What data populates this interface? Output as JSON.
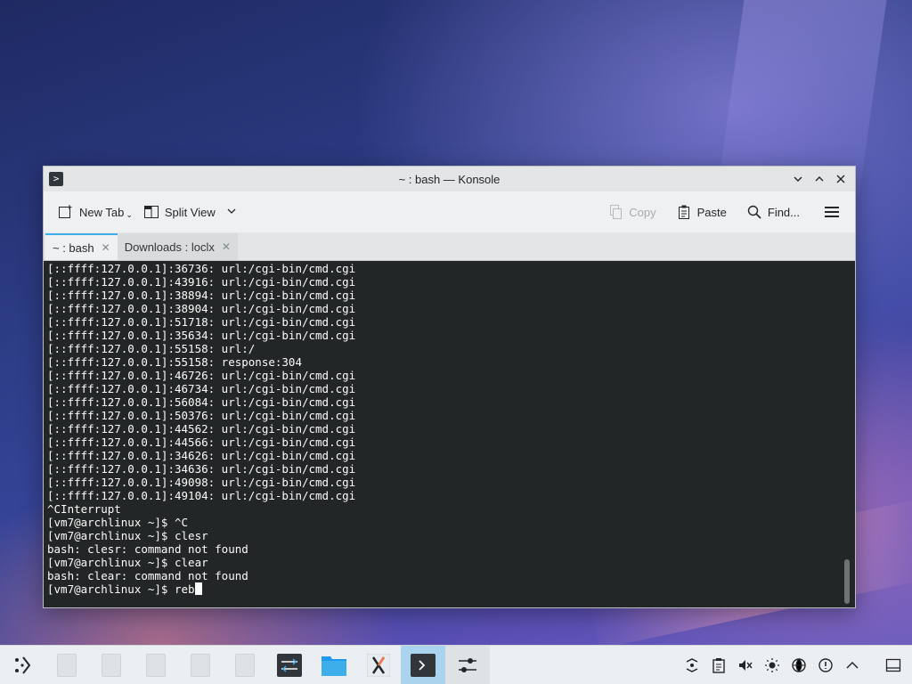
{
  "window": {
    "title": "~ : bash — Konsole"
  },
  "toolbar": {
    "new_tab": "New Tab",
    "split_view": "Split View",
    "copy": "Copy",
    "paste": "Paste",
    "find": "Find..."
  },
  "tabs": [
    {
      "label": "~ : bash",
      "active": true
    },
    {
      "label": "Downloads : loclx",
      "active": false
    }
  ],
  "terminal": {
    "lines": [
      "[::ffff:127.0.0.1]:36736: url:/cgi-bin/cmd.cgi",
      "[::ffff:127.0.0.1]:43916: url:/cgi-bin/cmd.cgi",
      "[::ffff:127.0.0.1]:38894: url:/cgi-bin/cmd.cgi",
      "[::ffff:127.0.0.1]:38904: url:/cgi-bin/cmd.cgi",
      "[::ffff:127.0.0.1]:51718: url:/cgi-bin/cmd.cgi",
      "[::ffff:127.0.0.1]:35634: url:/cgi-bin/cmd.cgi",
      "[::ffff:127.0.0.1]:55158: url:/",
      "[::ffff:127.0.0.1]:55158: response:304",
      "[::ffff:127.0.0.1]:46726: url:/cgi-bin/cmd.cgi",
      "[::ffff:127.0.0.1]:46734: url:/cgi-bin/cmd.cgi",
      "[::ffff:127.0.0.1]:56084: url:/cgi-bin/cmd.cgi",
      "[::ffff:127.0.0.1]:50376: url:/cgi-bin/cmd.cgi",
      "[::ffff:127.0.0.1]:44562: url:/cgi-bin/cmd.cgi",
      "[::ffff:127.0.0.1]:44566: url:/cgi-bin/cmd.cgi",
      "[::ffff:127.0.0.1]:34626: url:/cgi-bin/cmd.cgi",
      "[::ffff:127.0.0.1]:34636: url:/cgi-bin/cmd.cgi",
      "[::ffff:127.0.0.1]:49098: url:/cgi-bin/cmd.cgi",
      "[::ffff:127.0.0.1]:49104: url:/cgi-bin/cmd.cgi",
      "^CInterrupt",
      "[vm7@archlinux ~]$ ^C",
      "[vm7@archlinux ~]$ clesr",
      "bash: clesr: command not found",
      "[vm7@archlinux ~]$ clear",
      "bash: clear: command not found"
    ],
    "prompt": "[vm7@archlinux ~]$ ",
    "current_input": "reb"
  },
  "taskbar": {
    "tasks": [
      {
        "icon": "document-icon",
        "active": false
      },
      {
        "icon": "document-icon",
        "active": false
      },
      {
        "icon": "document-icon",
        "active": false
      },
      {
        "icon": "document-icon",
        "active": false
      },
      {
        "icon": "document-icon",
        "active": false
      },
      {
        "icon": "system-settings-icon",
        "active": false
      },
      {
        "icon": "folder-icon",
        "active": false
      },
      {
        "icon": "xcode-x-icon",
        "active": false
      },
      {
        "icon": "konsole-icon",
        "active": true
      },
      {
        "icon": "mixer-sliders-icon",
        "active": false
      }
    ],
    "tray_icons": [
      "kdeconnect-icon",
      "clipboard-icon",
      "volume-muted-icon",
      "brightness-icon",
      "network-icon",
      "update-icon",
      "expand-tray-icon",
      "show-desktop-icon"
    ]
  }
}
